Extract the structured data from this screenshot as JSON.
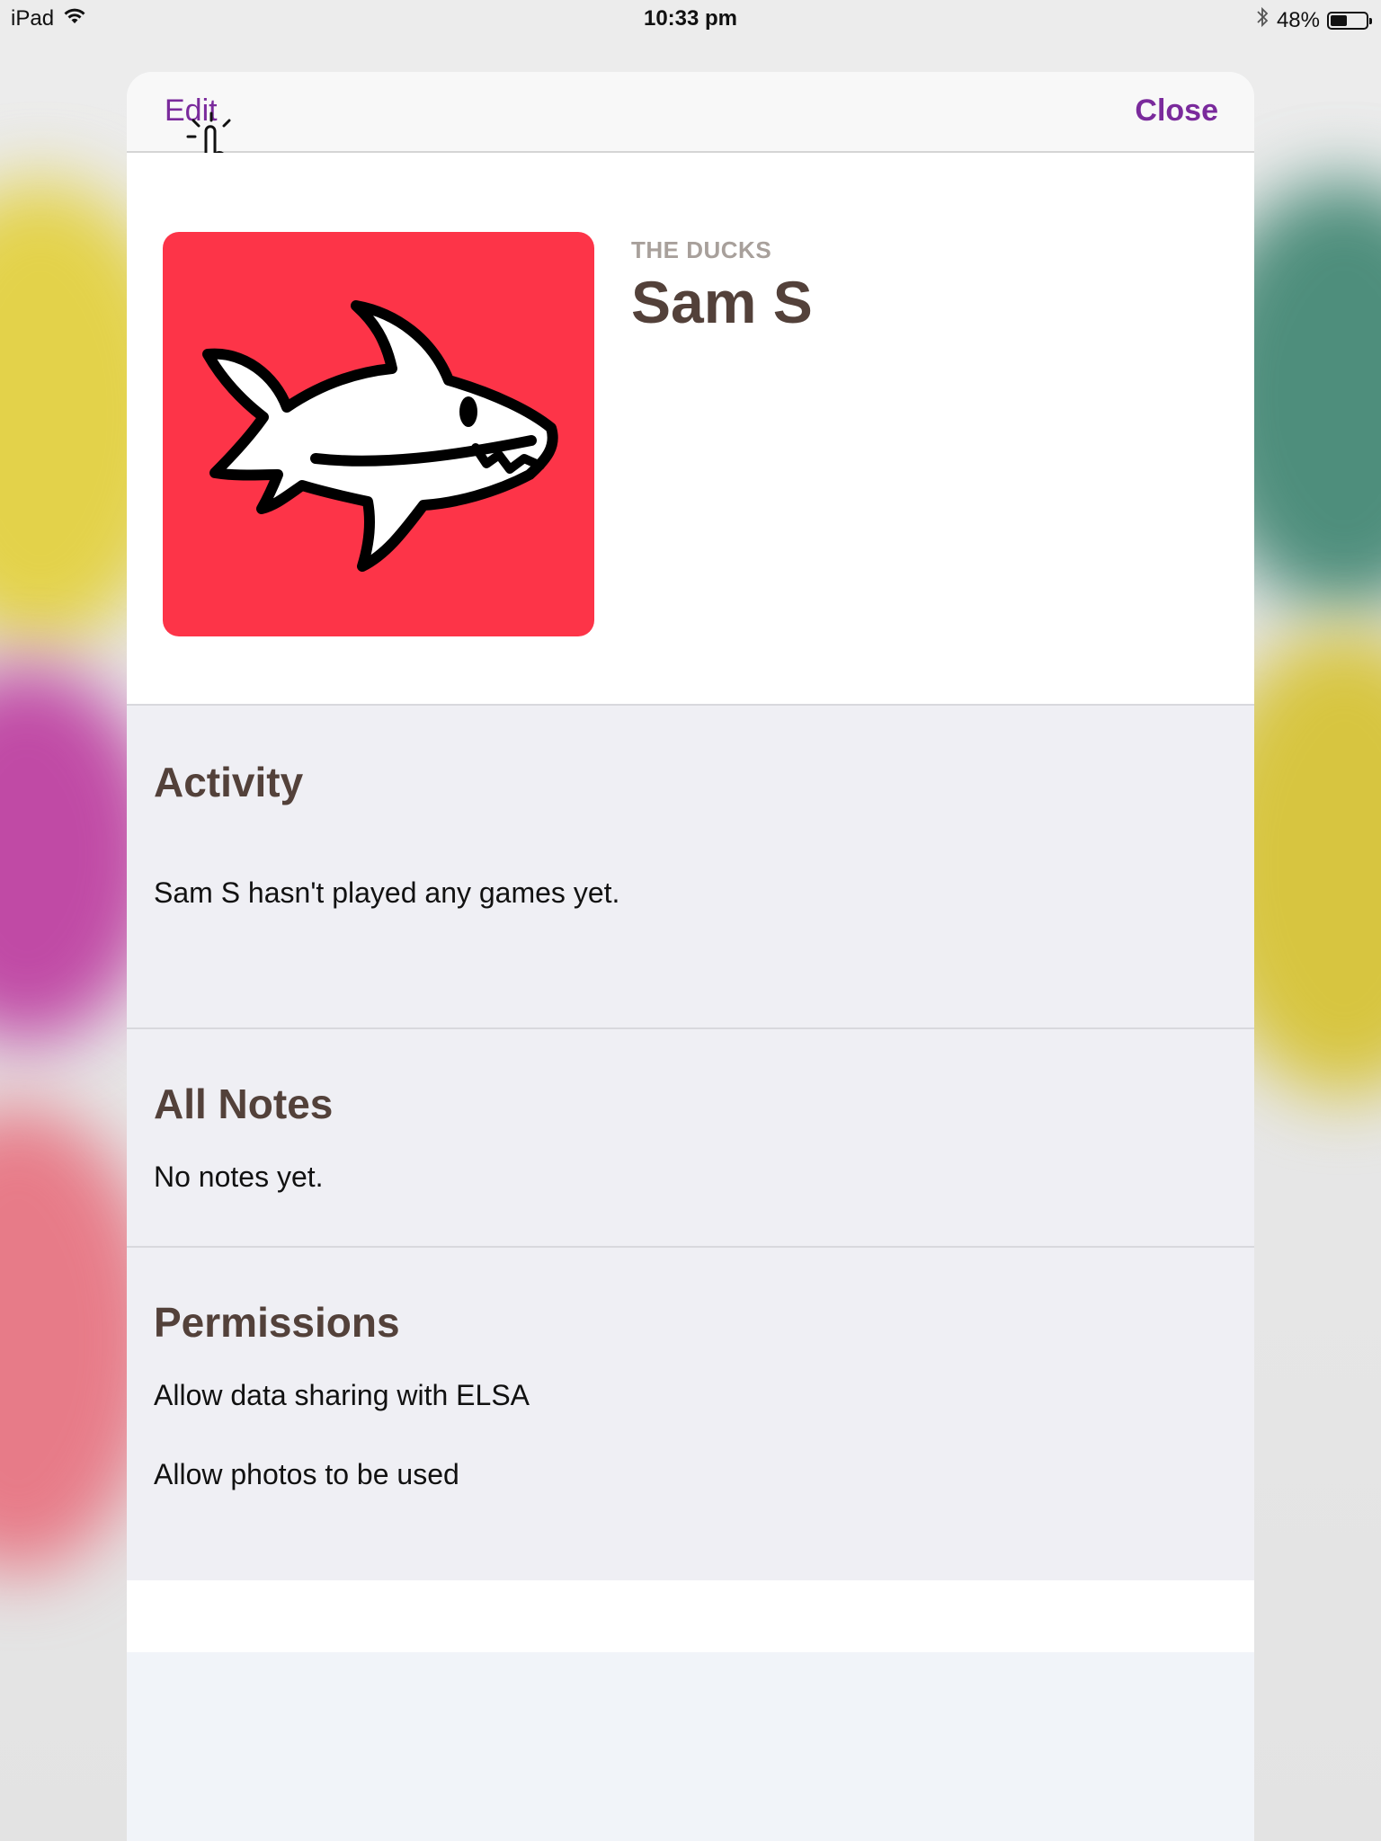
{
  "status_bar": {
    "device": "iPad",
    "time": "10:33 pm",
    "battery": "48%",
    "battery_level": 0.48
  },
  "nav": {
    "edit_label": "Edit",
    "close_label": "Close",
    "accent_color": "#7a2a9c"
  },
  "profile": {
    "team": "THE DUCKS",
    "name": "Sam S",
    "avatar_icon": "shark-icon",
    "avatar_color": "#fd3448"
  },
  "activity": {
    "title": "Activity",
    "message": "Sam S hasn't played any games yet."
  },
  "notes": {
    "title": "All Notes",
    "message": "No notes yet."
  },
  "permissions": {
    "title": "Permissions",
    "items": [
      {
        "label": "Allow data sharing with ELSA"
      },
      {
        "label": "Allow photos to be used"
      }
    ]
  }
}
